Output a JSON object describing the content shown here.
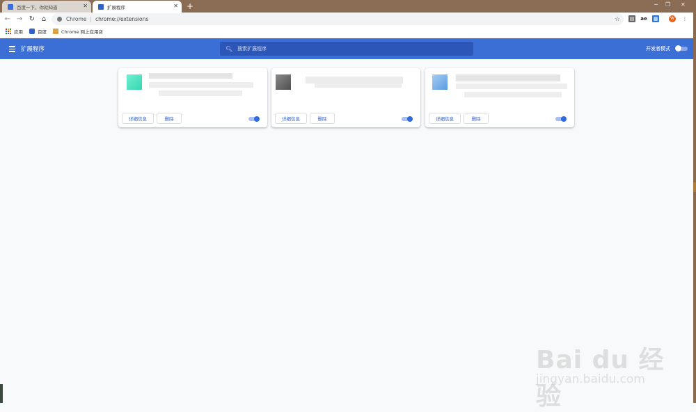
{
  "browser": {
    "tabs": [
      {
        "label": "百度一下，你就知道",
        "active": false,
        "icon": "baidu-paw-icon"
      },
      {
        "label": "扩展程序",
        "active": true,
        "icon": "puzzle-icon"
      }
    ],
    "new_tab_label": "+",
    "address": {
      "site_label": "Chrome",
      "separator": "|",
      "url": "chrome://extensions"
    },
    "avatar_initials": "W"
  },
  "bookmarks": [
    {
      "label": "应用",
      "icon": "apps-grid-icon"
    },
    {
      "label": "百度",
      "icon": "baidu-paw-icon"
    },
    {
      "label": "Chrome 网上应用店",
      "icon": "webstore-icon"
    }
  ],
  "extensions_page": {
    "title": "扩展程序",
    "search_placeholder": "搜索扩展程序",
    "dev_mode_label": "开发者模式",
    "dev_mode_enabled": false,
    "header_color": "#3b6fd6"
  },
  "cards": [
    {
      "details_label": "详细信息",
      "remove_label": "删除",
      "enabled": true,
      "icon_color": "#4fe0c2"
    },
    {
      "details_label": "详细信息",
      "remove_label": "删除",
      "enabled": true,
      "icon_color": "#6b6b6b"
    },
    {
      "details_label": "详细信息",
      "remove_label": "删除",
      "enabled": true,
      "icon_color": "#7fb3ea"
    }
  ],
  "watermark": {
    "logo": "Bai du 经验",
    "sub": "jingyan.baidu.com"
  }
}
